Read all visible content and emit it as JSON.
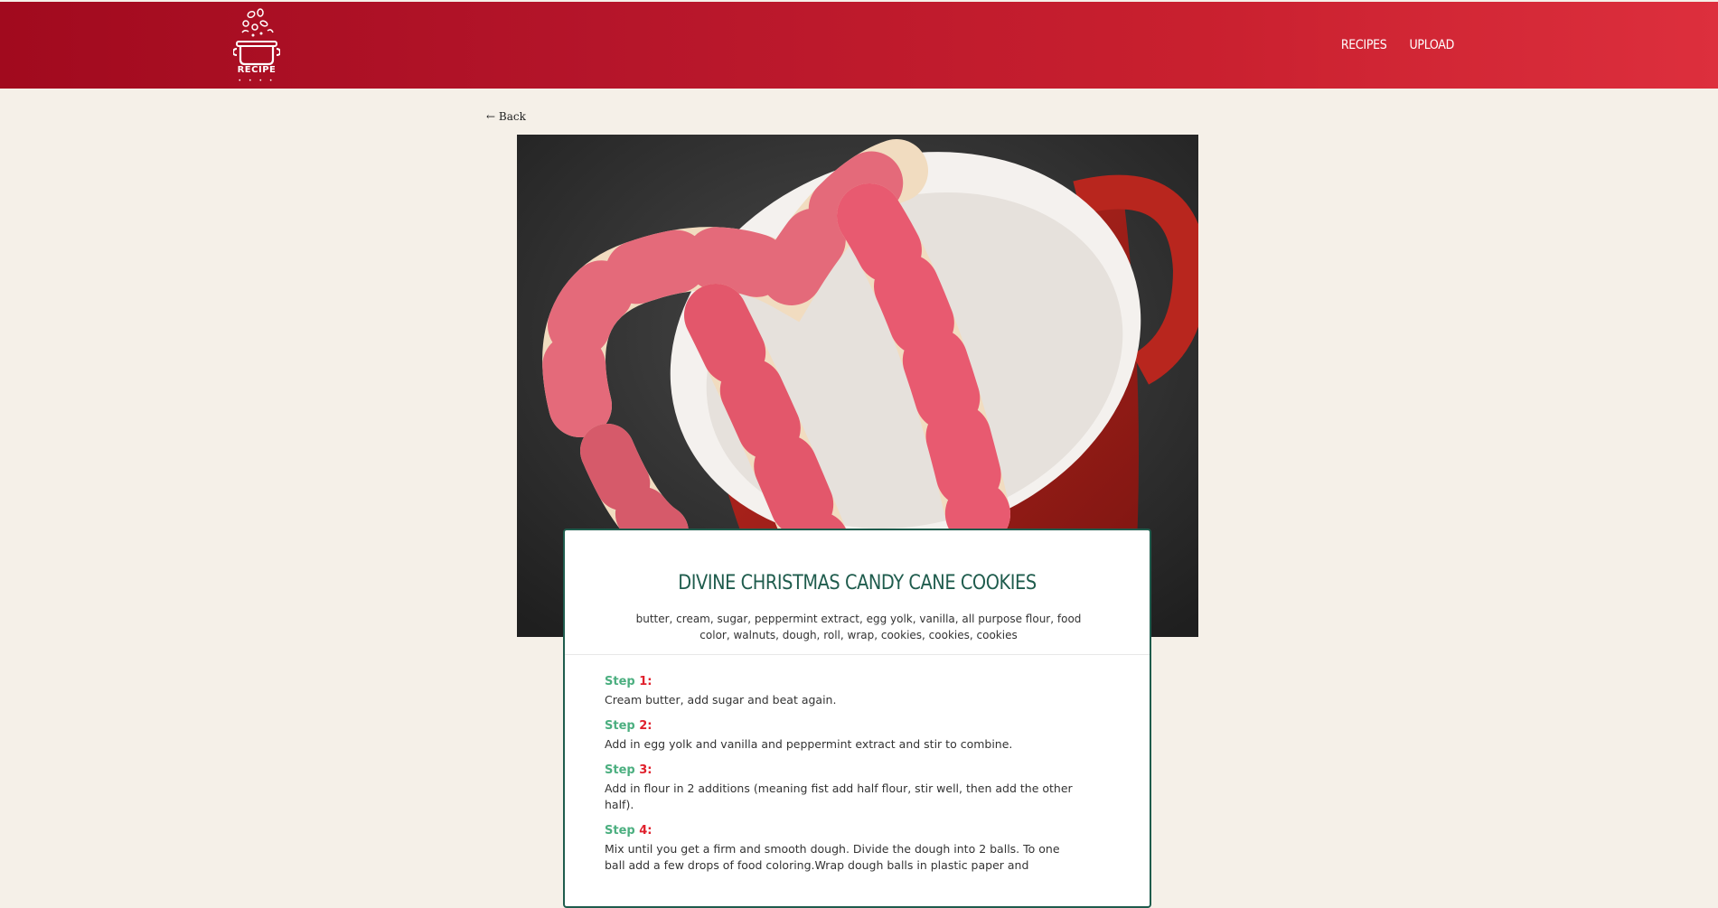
{
  "header": {
    "logo_text": "RECIPE",
    "logo_subtext": "• • • •",
    "nav": [
      {
        "label": "RECIPES"
      },
      {
        "label": "UPLOAD"
      }
    ]
  },
  "back_link": "← Back",
  "recipe": {
    "title": "DIVINE CHRISTMAS CANDY CANE COOKIES",
    "ingredients": "butter, cream, sugar, peppermint extract, egg yolk, vanilla, all purpose flour, food color, walnuts, dough, roll, wrap, cookies, cookies, cookies",
    "step_word": "Step",
    "steps": [
      {
        "num": "1",
        "text": "Cream butter, add sugar and beat again."
      },
      {
        "num": "2",
        "text": "Add in egg yolk and vanilla and peppermint extract and stir to combine."
      },
      {
        "num": "3",
        "text": "Add in flour in 2 additions (meaning fist add half flour, stir well, then add the other half)."
      },
      {
        "num": "4",
        "text": "Mix until you get a firm and smooth dough. Divide the dough into 2 balls. To one ball add a few drops of food coloring.Wrap dough balls in plastic paper and"
      }
    ]
  },
  "colors": {
    "header_start": "#a10a1e",
    "header_end": "#dd2f3d",
    "accent_green": "#1f5c4d",
    "step_green": "#4caf80",
    "step_red": "#e0202c",
    "page_bg": "#f5f0e8"
  }
}
